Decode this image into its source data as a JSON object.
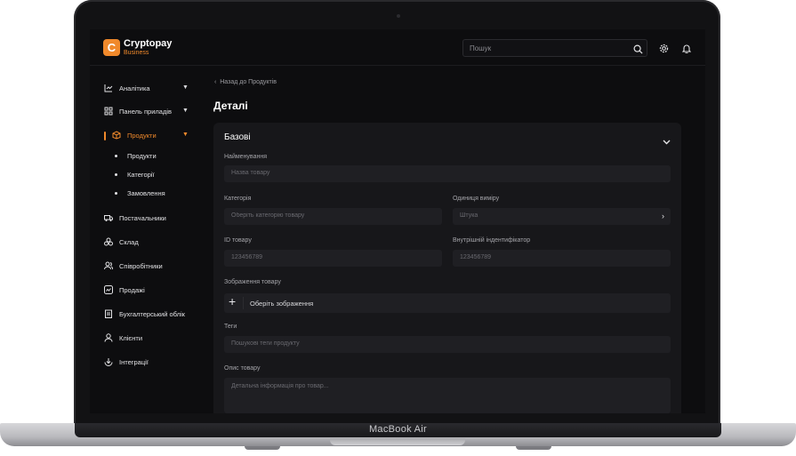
{
  "device": {
    "label": "MacBook Air"
  },
  "app": {
    "name": "Cryptopay",
    "subtitle": "Business",
    "logo_letter": "C",
    "accent": "#f0892b"
  },
  "topbar": {
    "search_placeholder": "Пошук",
    "icons": [
      "search-icon",
      "gear-icon",
      "bell-icon"
    ]
  },
  "sidebar": {
    "items": [
      {
        "label": "Аналітика",
        "icon": "chart-icon",
        "has_caret": true
      },
      {
        "label": "Панель приладів",
        "icon": "grid-icon",
        "has_caret": true
      },
      {
        "label": "Продукти",
        "icon": "box-icon",
        "has_caret": true,
        "active": true
      },
      {
        "label": "Постачальники",
        "icon": "truck-icon"
      },
      {
        "label": "Склад",
        "icon": "boxes-icon"
      },
      {
        "label": "Співробітники",
        "icon": "users-icon"
      },
      {
        "label": "Продажі",
        "icon": "sales-icon"
      },
      {
        "label": "Бухгалтерський облік",
        "icon": "ledger-icon"
      },
      {
        "label": "Клієнти",
        "icon": "user-icon"
      },
      {
        "label": "Інтеграції",
        "icon": "download-icon"
      }
    ],
    "subitems": [
      "Продукти",
      "Категорії",
      "Замовлення"
    ],
    "caret": "▼"
  },
  "main": {
    "back_label": "Назад до Продуктів",
    "title": "Деталі",
    "section_title": "Базові",
    "fields": {
      "name": {
        "label": "Найменування",
        "placeholder": "Назва товару"
      },
      "category": {
        "label": "Категорія",
        "placeholder": "Оберіть категорію товару"
      },
      "unit": {
        "label": "Одиниця виміру",
        "placeholder": "Штука"
      },
      "id": {
        "label": "ID товару",
        "placeholder": "123456789"
      },
      "internal_id": {
        "label": "Внутрішній індентифікатор",
        "placeholder": "123456789"
      },
      "image": {
        "label": "Зображення товару",
        "button": "Оберіть зображення",
        "plus": "+"
      },
      "tags": {
        "label": "Теги",
        "placeholder": "Пошукові теги продукту"
      },
      "description": {
        "label": "Опис товару",
        "placeholder": "Детальна інформація про товар..."
      }
    }
  }
}
